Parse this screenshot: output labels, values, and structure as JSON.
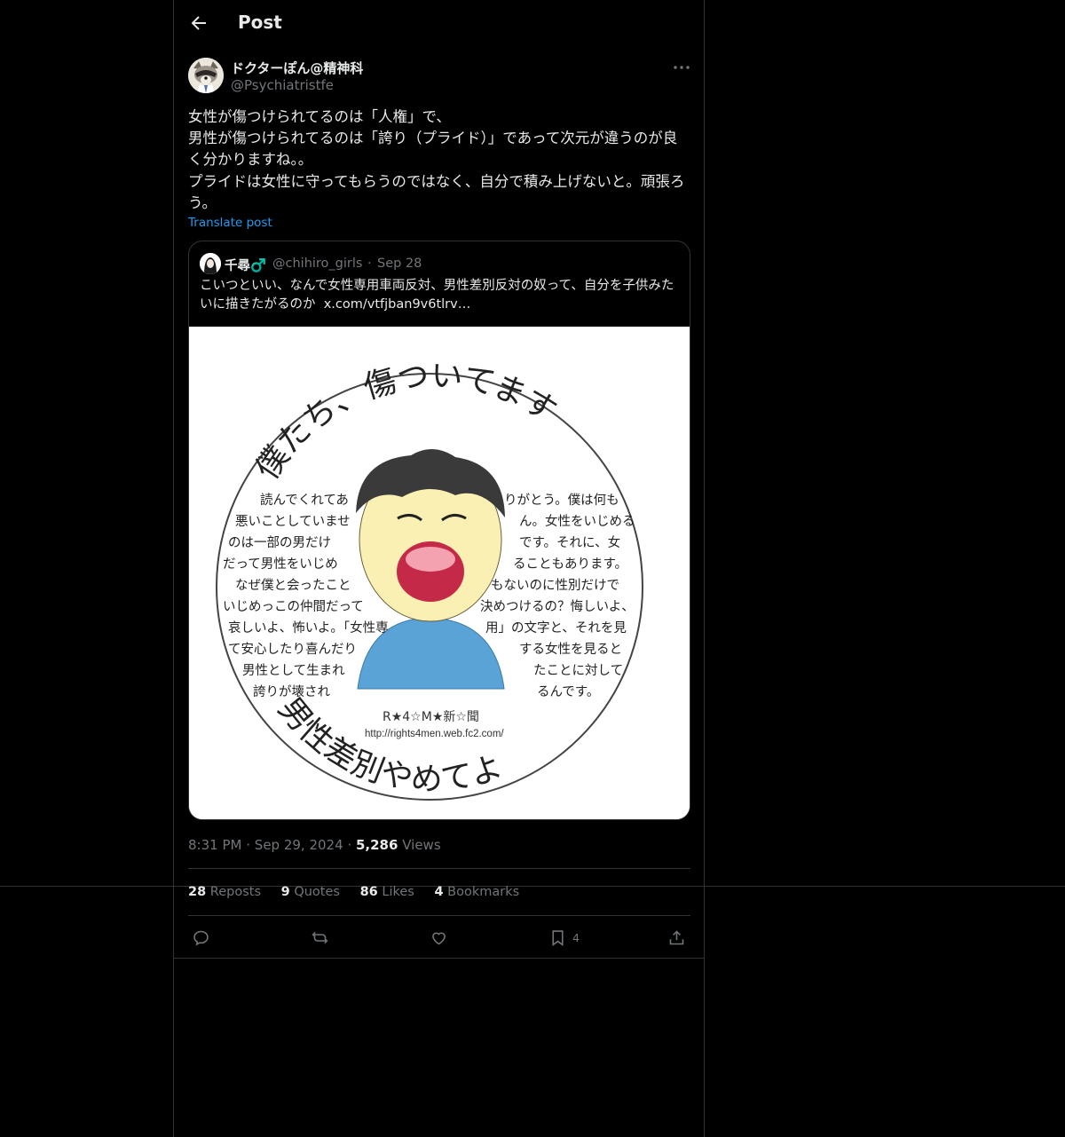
{
  "header": {
    "title": "Post"
  },
  "post": {
    "author_name": "ドクターぽん@精神科",
    "author_handle": "@Psychiatristfe",
    "text": "女性が傷つけられてるのは「人権」で、\n男性が傷つけられてるのは「誇り（プライド）」であって次元が違うのが良く分かりますね。。\nプライドは女性に守ってもらうのではなく、自分で積み上げないと。頑張ろう。",
    "translate_label": "Translate post",
    "time": "8:31 PM",
    "date": "Sep 29, 2024",
    "views_count": "5,286",
    "views_label": "Views",
    "sep": "·"
  },
  "quote": {
    "name": "千尋♂️",
    "handle": "@chihiro_girls",
    "dot": "·",
    "date": "Sep 28",
    "text": "こいつといい、なんで女性専用車両反対、男性差別反対の奴って、自分を子供みたいに描きたがるのか  ",
    "link": "x.com/vtfjban9v6tlrv…",
    "image": {
      "title_top": "僕たち、傷ついてます",
      "title_bottom": "男性差別やめてよ",
      "left_lines": [
        "読んでくれてあ",
        "悪いことしていませ",
        "のは一部の男だけ",
        "だって男性をいじめ",
        "なぜ僕と会ったこと",
        "いじめっこの仲間だって",
        "哀しいよ、怖いよ。「女性専",
        "て安心したり喜んだり",
        "男性として生まれ",
        "誇りが壊され"
      ],
      "right_lines": [
        "りがとう。僕は何も",
        "ん。女性をいじめる",
        "です。それに、女",
        "ることもあります。",
        "もないのに性別だけで",
        "決めつけるの？悔しいよ、",
        "用」の文字と、それを見",
        "する女性を見ると",
        "たことに対して",
        "るんです。"
      ],
      "sign": "R★4☆M★新☆聞",
      "url": "http://rights4men.web.fc2.com/"
    }
  },
  "stats": {
    "reposts_count": "28",
    "reposts_label": "Reposts",
    "quotes_count": "9",
    "quotes_label": "Quotes",
    "likes_count": "86",
    "likes_label": "Likes",
    "bookmarks_count": "4",
    "bookmarks_label": "Bookmarks"
  },
  "actions": {
    "bookmark_count": "4"
  },
  "icons": [
    "back-arrow-icon",
    "more-icon",
    "reply-icon",
    "repost-icon",
    "like-icon",
    "bookmark-icon",
    "share-icon"
  ],
  "colors": {
    "background": "#000000",
    "text": "#e7e9ea",
    "muted": "#71767b",
    "link": "#1d9bf0",
    "border": "#2f3336"
  }
}
